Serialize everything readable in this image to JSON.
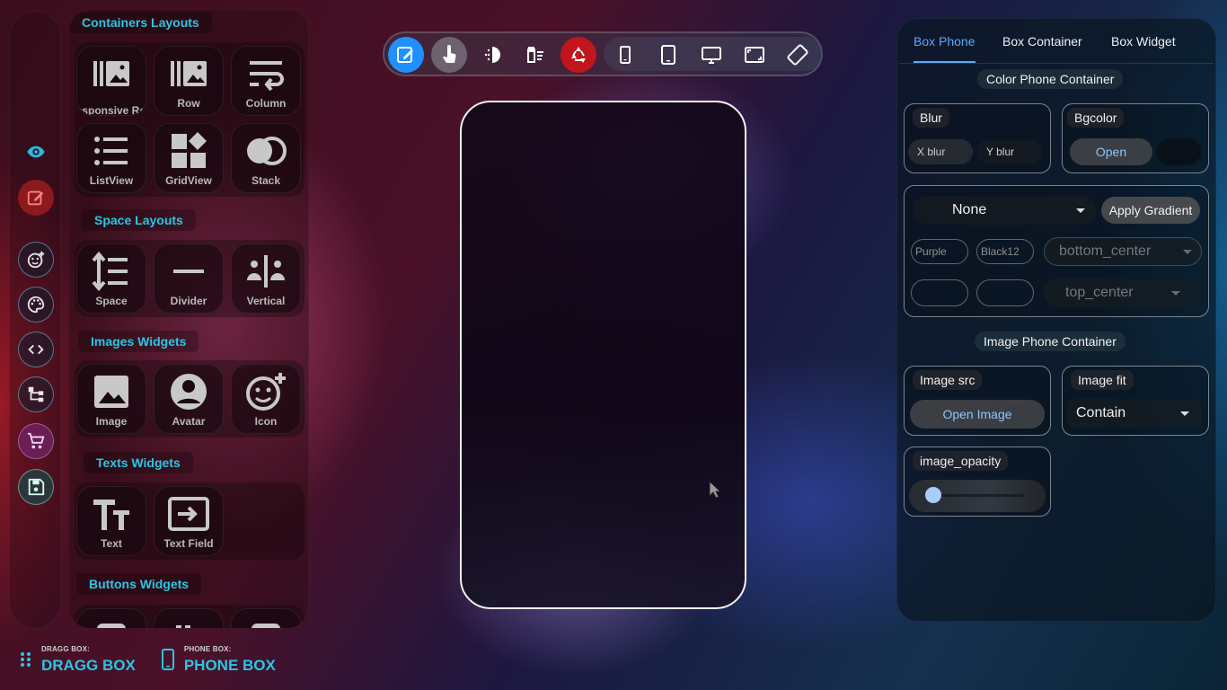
{
  "widget_panel": {
    "sections": {
      "containers": "Containers Layouts",
      "space": "Space Layouts",
      "images": "Images Widgets",
      "texts": "Texts Widgets",
      "buttons": "Buttons Widgets"
    },
    "containers": [
      "Responsive Row",
      "Row",
      "Column",
      "ListView",
      "GridView",
      "Stack"
    ],
    "space": [
      "Space",
      "Divider",
      "Vertical"
    ],
    "images": [
      "Image",
      "Avatar",
      "Icon"
    ],
    "texts": [
      "Text",
      "Text Field"
    ]
  },
  "bottom": {
    "dragg_small": "DRAGG BOX:",
    "dragg_big": "DRAGG BOX",
    "phone_small": "PHONE BOX:",
    "phone_big": "PHONE BOX"
  },
  "props": {
    "tabs": [
      "Box Phone",
      "Box Container",
      "Box Widget"
    ],
    "color_title": "Color Phone Container",
    "blur_label": "Blur",
    "x_blur": "X blur",
    "y_blur": "Y blur",
    "bgcolor_label": "Bgcolor",
    "open_label": "Open",
    "gradient_select": "None",
    "apply_gradient": "Apply Gradient",
    "color1": "Purple",
    "color2": "Black12",
    "begin_align": "bottom_center",
    "end_align": "top_center",
    "image_title": "Image Phone Container",
    "image_src_label": "Image src",
    "open_image": "Open Image",
    "image_fit_label": "Image fit",
    "image_fit_value": "Contain",
    "opacity_label": "image_opacity",
    "opacity_value": 0.0
  },
  "colors": {
    "accent": "#29c6e6",
    "tab_active": "#58a9ff",
    "edit_active": "#1e90ff",
    "recycle": "#c0161c"
  }
}
